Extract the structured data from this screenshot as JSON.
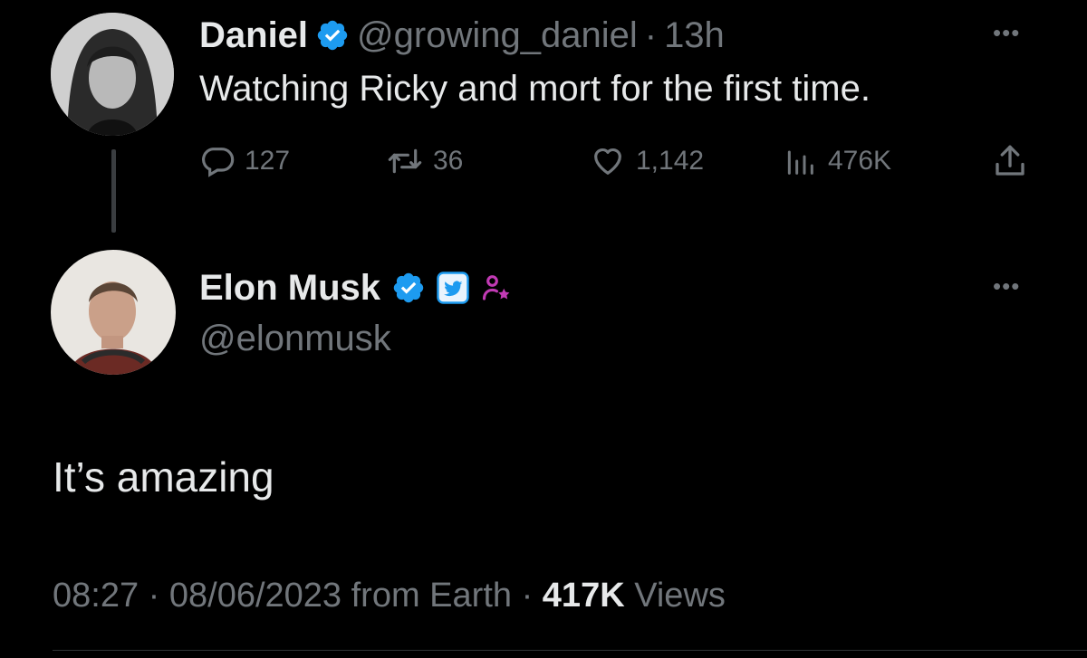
{
  "parent_tweet": {
    "author_name": "Daniel",
    "handle": "@growing_daniel",
    "separator": "·",
    "time": "13h",
    "text": "Watching Ricky and mort for the first time.",
    "stats": {
      "replies": "127",
      "retweets": "36",
      "likes": "1,142",
      "views": "476K"
    }
  },
  "reply_tweet": {
    "author_name": "Elon Musk",
    "handle": "@elonmusk",
    "text": "It’s amazing",
    "footer": {
      "time": "08:27",
      "separator": "·",
      "date": "08/06/2023",
      "source": "from Earth",
      "separator2": "·",
      "views_count": "417K",
      "views_label": "Views"
    }
  },
  "colors": {
    "background": "#000000",
    "text": "#e7e9ea",
    "muted": "#71767b",
    "verified": "#1d9bf0",
    "affiliate_badge": "#c13ab4"
  },
  "icons": [
    "verified-badge-icon",
    "more-options-icon",
    "reply-icon",
    "retweet-icon",
    "like-icon",
    "views-icon",
    "share-icon",
    "twitter-affiliate-icon",
    "person-star-icon"
  ]
}
